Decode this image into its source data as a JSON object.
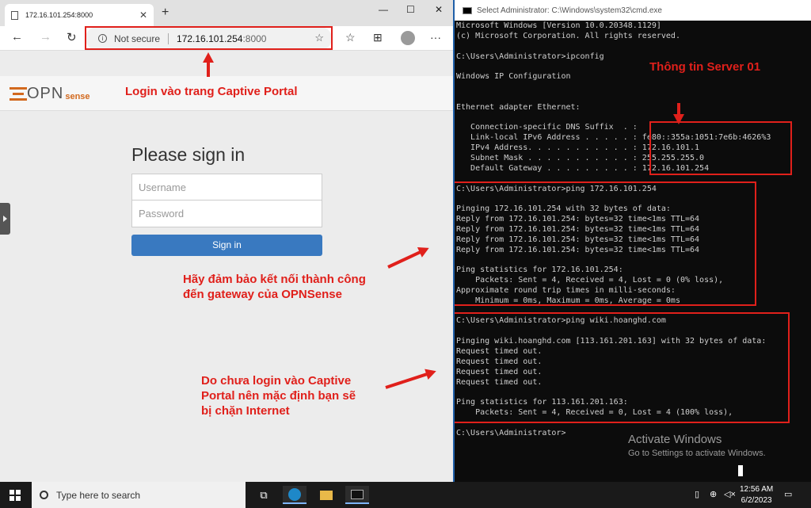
{
  "browser": {
    "tab_title": "172.16.101.254:8000",
    "not_secure": "Not secure",
    "url_host": "172.16.101.254",
    "url_port": ":8000"
  },
  "portal": {
    "logo_opn": "OPN",
    "logo_sense": "sense",
    "heading": "Please sign in",
    "username_placeholder": "Username",
    "password_placeholder": "Password",
    "signin_label": "Sign in"
  },
  "annotations": {
    "login": "Login vào trang Captive Portal",
    "gateway_line1": "Hãy đảm bảo kết nối thành công",
    "gateway_line2": "đến gateway của OPNSense",
    "blocked_line1": "Do chưa login vào Captive",
    "blocked_line2": "Portal nên mặc định bạn sẽ",
    "blocked_line3": "bị chặn Internet",
    "server": "Thông tin Server 01"
  },
  "cmd": {
    "title": "Select Administrator: C:\\Windows\\system32\\cmd.exe",
    "lines": [
      "Microsoft Windows [Version 10.0.20348.1129]",
      "(c) Microsoft Corporation. All rights reserved.",
      "",
      "C:\\Users\\Administrator>ipconfig",
      "",
      "Windows IP Configuration",
      "",
      "",
      "Ethernet adapter Ethernet:",
      "",
      "   Connection-specific DNS Suffix  . :",
      "   Link-local IPv6 Address . . . . . : fe80::355a:1051:7e6b:4626%3",
      "   IPv4 Address. . . . . . . . . . . : 172.16.101.1",
      "   Subnet Mask . . . . . . . . . . . : 255.255.255.0",
      "   Default Gateway . . . . . . . . . : 172.16.101.254",
      "",
      "C:\\Users\\Administrator>ping 172.16.101.254",
      "",
      "Pinging 172.16.101.254 with 32 bytes of data:",
      "Reply from 172.16.101.254: bytes=32 time<1ms TTL=64",
      "Reply from 172.16.101.254: bytes=32 time<1ms TTL=64",
      "Reply from 172.16.101.254: bytes=32 time<1ms TTL=64",
      "Reply from 172.16.101.254: bytes=32 time<1ms TTL=64",
      "",
      "Ping statistics for 172.16.101.254:",
      "    Packets: Sent = 4, Received = 4, Lost = 0 (0% loss),",
      "Approximate round trip times in milli-seconds:",
      "    Minimum = 0ms, Maximum = 0ms, Average = 0ms",
      "",
      "C:\\Users\\Administrator>ping wiki.hoanghd.com",
      "",
      "Pinging wiki.hoanghd.com [113.161.201.163] with 32 bytes of data:",
      "Request timed out.",
      "Request timed out.",
      "Request timed out.",
      "Request timed out.",
      "",
      "Ping statistics for 113.161.201.163:",
      "    Packets: Sent = 4, Received = 0, Lost = 4 (100% loss),",
      "",
      "C:\\Users\\Administrator>"
    ],
    "activate_title": "Activate Windows",
    "activate_sub": "Go to Settings to activate Windows."
  },
  "taskbar": {
    "search_placeholder": "Type here to search",
    "time": "12:56 AM",
    "date": "6/2/2023"
  },
  "colors": {
    "annotation_red": "#e0201b",
    "opnsense_orange": "#d2691e",
    "signin_blue": "#3979c0"
  }
}
